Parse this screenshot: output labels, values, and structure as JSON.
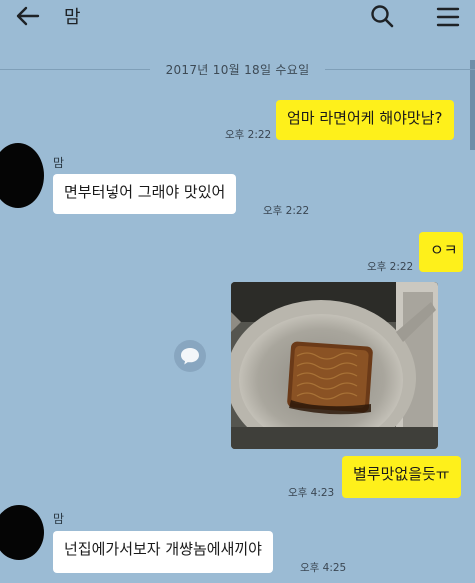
{
  "header": {
    "back_icon": "arrow-left-icon",
    "title": "맘",
    "search_icon": "search-icon",
    "menu_icon": "hamburger-menu-icon"
  },
  "date_divider": "2017년 10월 18일 수요일",
  "messages": [
    {
      "from": "me",
      "text": "엄마 라면어케 해야맛남?",
      "time": "오후 2:22"
    },
    {
      "from": "them",
      "sender": "맘",
      "text": "면부터넣어  그래야 맛있어",
      "time": "오후 2:22"
    },
    {
      "from": "me",
      "text": "ㅇㅋ",
      "time": "오후 2:22"
    },
    {
      "from": "me",
      "type": "photo",
      "alt": "냄비 속 라면"
    },
    {
      "from": "me",
      "text": "별루맛없을듯ㅠ",
      "time": "오후 4:23"
    },
    {
      "from": "them",
      "sender": "맘",
      "text": "넌집에가서보자 개썅놈에새끼야",
      "time": "오후 4:25"
    }
  ],
  "share_icon": "share-bubble-icon",
  "colors": {
    "background": "#9bbbd4",
    "my_bubble": "#fef01b",
    "their_bubble": "#ffffff"
  }
}
